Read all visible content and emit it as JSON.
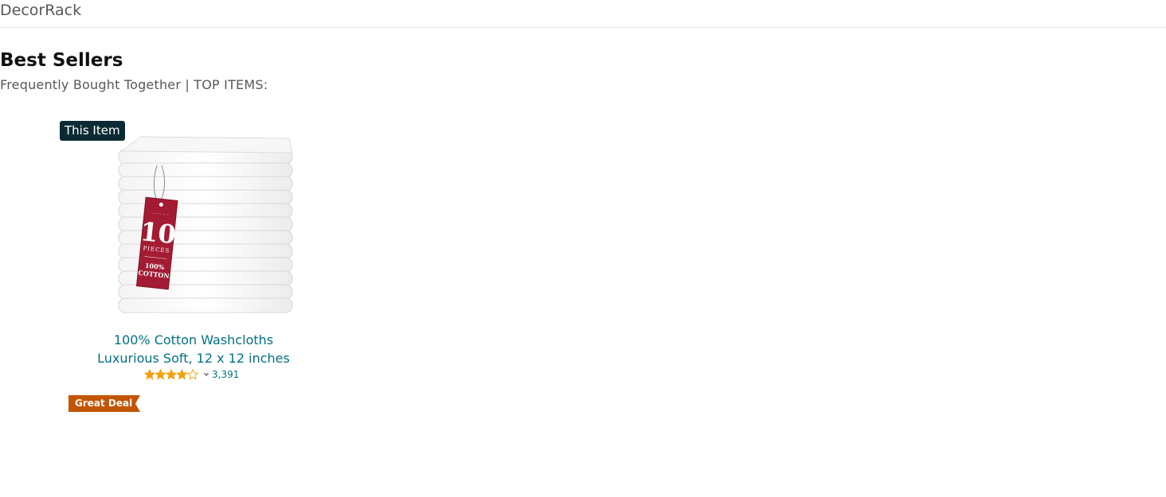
{
  "header": {
    "brand": "DecorRack"
  },
  "section": {
    "title": "Best Sellers",
    "subtitle": "Frequently Bought Together | TOP ITEMS:"
  },
  "product": {
    "badge": "This Item",
    "title_line1": "100% Cotton Washcloths",
    "title_line2": "Luxurious Soft, 12 x 12 inches",
    "tag_number": "10",
    "tag_pieces": "PIECES",
    "tag_material_line1": "100%",
    "tag_material_line2": "COTTON",
    "rating_stars": 4,
    "rating_max": 5,
    "review_count": "3,391",
    "deal_label": "Great Deal"
  },
  "colors": {
    "badge_bg": "#0a2b33",
    "link": "#007185",
    "star": "#f0a10c",
    "deal": "#c45500",
    "tag": "#a31c34"
  },
  "icons": {
    "stars": "star-rating-icon",
    "chevron": "chevron-down-icon"
  }
}
